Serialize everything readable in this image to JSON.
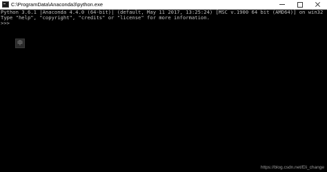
{
  "window": {
    "title": "C:\\ProgramData\\Anaconda3\\python.exe",
    "app_icon": "console-icon",
    "controls": {
      "minimize_icon": "minimize-icon",
      "maximize_icon": "maximize-icon",
      "close_icon": "close-icon"
    }
  },
  "console": {
    "lines": [
      "Python 3.6.1 |Anaconda 4.4.0 (64-bit)| (default, May 11 2017, 13:25:24) [MSC v.1900 64 bit (AMD64)] on win32",
      "Type \"help\", \"copyright\", \"credits\" or \"license\" for more information.",
      ">>> "
    ],
    "text_color": "#c0c0c0",
    "background": "#000000"
  },
  "ime_indicator": {
    "label": "中"
  },
  "watermark": {
    "text": "https://blog.csdn.net/Eli_change"
  }
}
